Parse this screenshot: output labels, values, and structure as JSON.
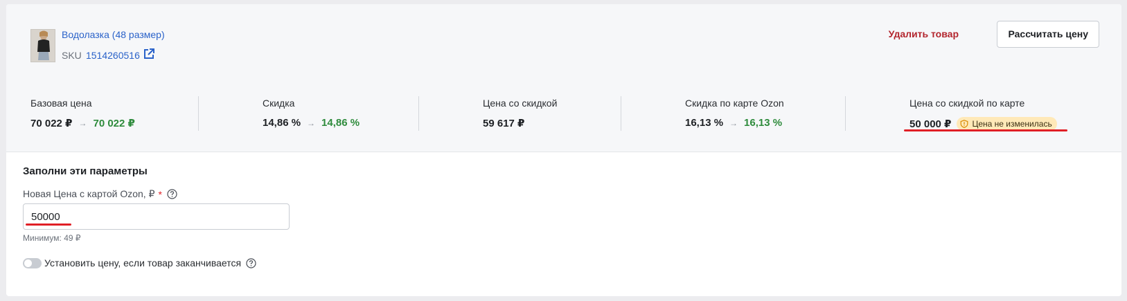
{
  "product": {
    "name": "Водолазка (48 размер)",
    "sku_label": "SKU",
    "sku_value": "1514260516"
  },
  "actions": {
    "delete_label": "Удалить товар",
    "calc_label": "Рассчитать цену"
  },
  "metrics": [
    {
      "label": "Базовая цена",
      "old": "70 022 ₽",
      "new": "70 022 ₽"
    },
    {
      "label": "Скидка",
      "old": "14,86 %",
      "new": "14,86 %"
    },
    {
      "label": "Цена со скидкой",
      "old": "59 617 ₽"
    },
    {
      "label": "Скидка по карте Ozon",
      "old": "16,13 %",
      "new": "16,13 %"
    },
    {
      "label": "Цена со скидкой по карте",
      "old": "50 000 ₽",
      "badge": "Цена не изменилась"
    }
  ],
  "form": {
    "section_title": "Заполни эти параметры",
    "price_label": "Новая Цена с картой Ozon, ₽",
    "required_mark": "*",
    "price_value": "50000",
    "min_hint": "Минимум: 49 ₽",
    "toggle_label": "Установить цену, если товар заканчивается",
    "toggle_on": false
  },
  "colors": {
    "link": "#2a62c9",
    "danger": "#b3252d",
    "positive": "#2e8b3c",
    "badge_bg": "#ffe9b8",
    "highlight": "#e01f26"
  },
  "icons": {
    "external_link": "external-link-icon",
    "arrow": "arrow-right-icon",
    "warning": "shield-warning-icon",
    "help": "question-circle-icon"
  }
}
